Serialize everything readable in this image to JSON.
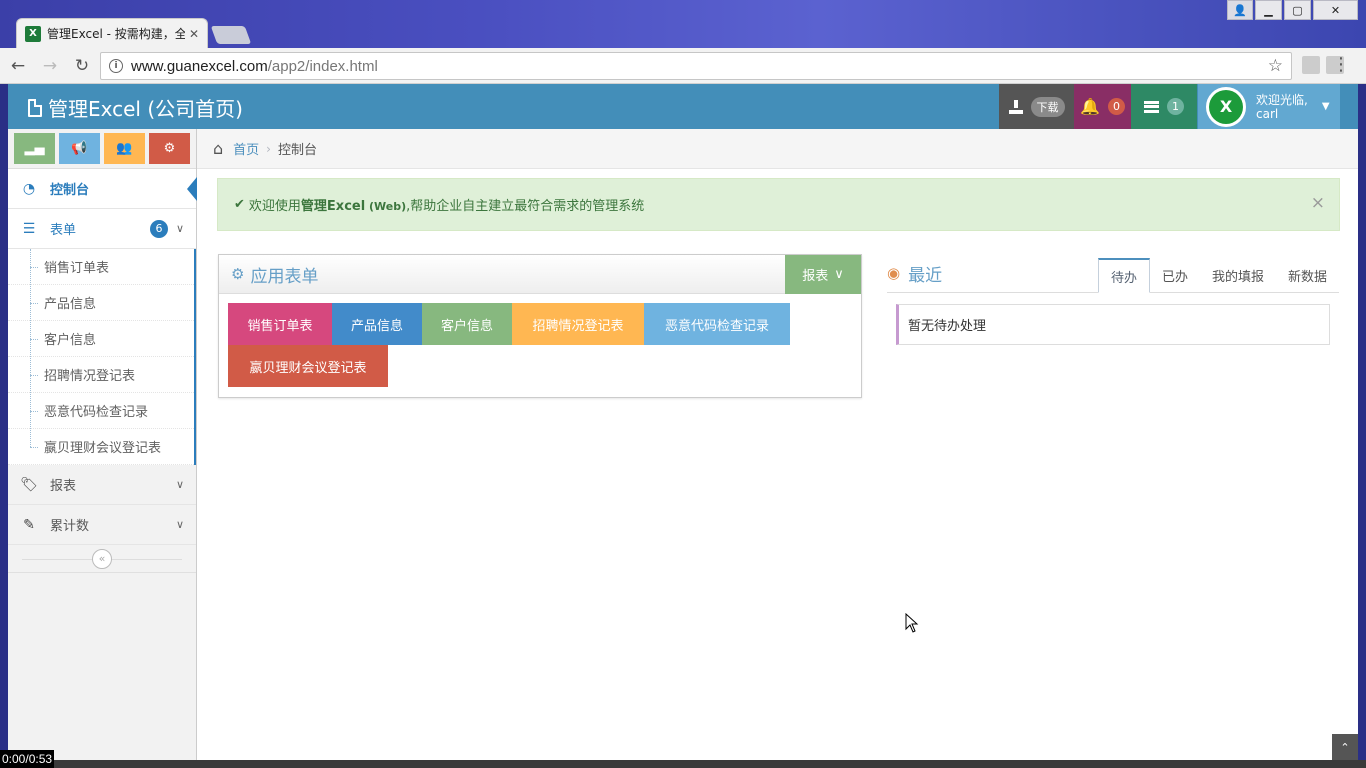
{
  "browser": {
    "tab_title": "管理Excel - 按需构建，全",
    "tab_favicon": "X",
    "url_host": "www.guanexcel.com",
    "url_path": "/app2/index.html"
  },
  "header": {
    "brand": "管理Excel (公司首页)",
    "download_label": "下载",
    "notifications_count": "0",
    "tasks_count": "1",
    "welcome": "欢迎光临,",
    "username": "carl",
    "avatar_letter": "X"
  },
  "sidebar": {
    "items": [
      {
        "label": "控制台"
      },
      {
        "label": "表单",
        "badge": "6"
      },
      {
        "label": "报表"
      },
      {
        "label": "累计数"
      }
    ],
    "sub_items": [
      "销售订单表",
      "产品信息",
      "客户信息",
      "招聘情况登记表",
      "恶意代码检查记录",
      "嬴贝理财会议登记表"
    ]
  },
  "breadcrumbs": {
    "home": "首页",
    "current": "控制台"
  },
  "alert": {
    "prefix": "欢迎使用 ",
    "product": "管理Excel",
    "product_small": " (Web)",
    "suffix": " ,帮助企业自主建立最符合需求的管理系统",
    "close": "×"
  },
  "apps_widget": {
    "title": "应用表单",
    "button": "报表",
    "tiles": [
      "销售订单表",
      "产品信息",
      "客户信息",
      "招聘情况登记表",
      "恶意代码检查记录",
      "嬴贝理财会议登记表"
    ]
  },
  "recent": {
    "title": "最近",
    "tabs": [
      "待办",
      "已办",
      "我的填报",
      "新数据"
    ],
    "empty": "暂无待办处理"
  },
  "video": {
    "time": "0:00/0:53"
  },
  "colors": {
    "header_bg": "#438eb9",
    "accent": "#2b7dbc",
    "success_bg": "#dff0d8"
  }
}
